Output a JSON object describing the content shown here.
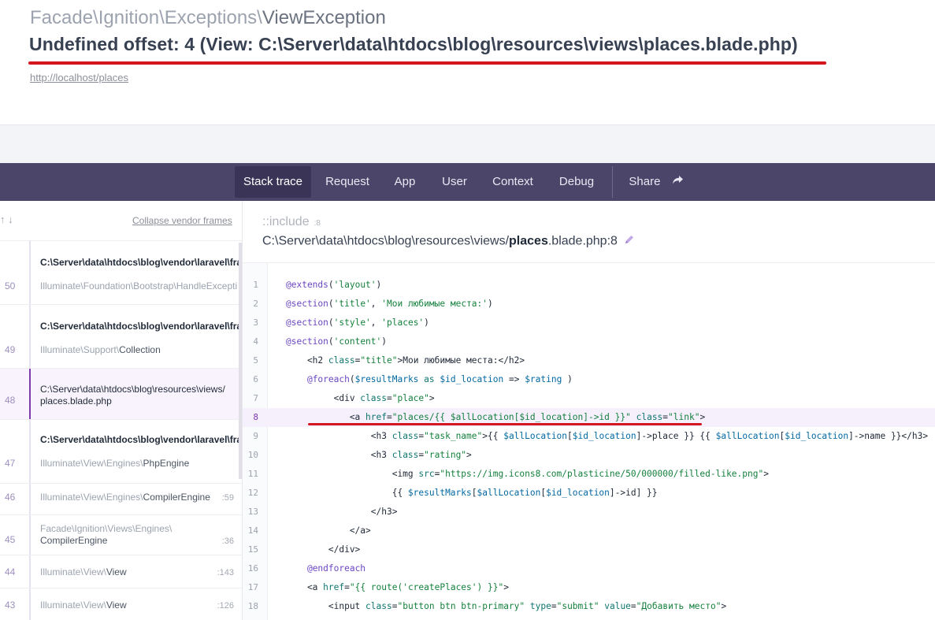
{
  "header": {
    "exception_ns": "Facade\\Ignition\\Exceptions\\",
    "exception_name": "ViewException",
    "message": "Undefined offset: 4 (View: C:\\Server\\data\\htdocs\\blog\\resources\\views\\places.blade.php)",
    "url": "http://localhost/places"
  },
  "nav": {
    "tabs": [
      "Stack trace",
      "Request",
      "App",
      "User",
      "Context",
      "Debug"
    ],
    "share": "Share"
  },
  "stack": {
    "arrows": "↑ ↓",
    "collapse": "Collapse vendor frames",
    "frames": [
      {
        "num": "50",
        "path": "C:\\Server\\data\\htdocs\\blog\\vendor\\laravel\\fra",
        "cls": "Illuminate\\Foundation\\Bootstrap\\HandleExcepti",
        "line": ""
      },
      {
        "num": "49",
        "path": "C:\\Server\\data\\htdocs\\blog\\vendor\\laravel\\fra",
        "cls": "Illuminate\\Support\\Collection",
        "line": ""
      },
      {
        "num": "48",
        "path": "C:\\Server\\data\\htdocs\\blog\\resources\\views/",
        "path2": "places.blade.php",
        "line": ""
      },
      {
        "num": "47",
        "path": "C:\\Server\\data\\htdocs\\blog\\vendor\\laravel\\fra",
        "cls": "Illuminate\\View\\Engines\\PhpEngine",
        "line": ""
      },
      {
        "num": "46",
        "cls": "Illuminate\\View\\Engines\\CompilerEngine",
        "line": ":59"
      },
      {
        "num": "45",
        "cls": "Facade\\Ignition\\Views\\Engines\\",
        "cls2": "CompilerEngine",
        "line": ":36"
      },
      {
        "num": "44",
        "cls": "Illuminate\\View\\View",
        "line": ":143"
      },
      {
        "num": "43",
        "cls": "Illuminate\\View\\View",
        "line": ":126"
      }
    ]
  },
  "source": {
    "include": "::include",
    "include_line": ":8",
    "file_prefix": "C:\\Server\\data\\htdocs\\blog\\resources\\views/",
    "file_bold": "places",
    "file_suffix": ".blade.php:8",
    "highlight_line": 8,
    "lines": [
      "@extends('layout')",
      "@section('title', 'Мои любимые места:')",
      "@section('style', 'places')",
      "@section('content')",
      "    <h2 class=\"title\">Мои любимые места:</h2>",
      "    @foreach($resultMarks as $id_location => $rating )",
      "         <div class=\"place\">",
      "            <a href=\"places/{{ $allLocation[$id_location]->id }}\" class=\"link\">",
      "                <h3 class=\"task_name\">{{ $allLocation[$id_location]->place }} {{ $allLocation[$id_location]->name }}</h3>",
      "                <h3 class=\"rating\">",
      "                    <img src=\"https://img.icons8.com/plasticine/50/000000/filled-like.png\">",
      "                    {{ $resultMarks[$allLocation[$id_location]->id] }}",
      "                </h3>",
      "            </a>",
      "        </div>",
      "    @endforeach",
      "    <a href=\"{{ route('createPlaces') }}\">",
      "        <input class=\"button btn btn-primary\" type=\"submit\" value=\"Добавить место\">"
    ]
  }
}
